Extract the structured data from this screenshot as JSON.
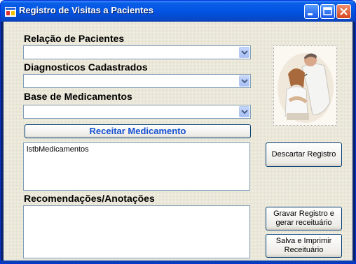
{
  "window": {
    "title": "Registro de Visitas a Pacientes"
  },
  "labels": {
    "pacientes": "Relação de Pacientes",
    "diagnosticos": "Diagnosticos Cadastrados",
    "medicamentos": "Base de Medicamentos",
    "recomendacoes": "Recomendações/Anotações"
  },
  "combos": {
    "pacientes": "",
    "diagnosticos": "",
    "medicamentos": ""
  },
  "buttons": {
    "receitar": "Receitar Medicamento",
    "descartar": "Descartar Registro",
    "gravar": "Gravar  Registro e gerar receituário",
    "salvar": "Salva e Imprimir Receituário"
  },
  "listbox": {
    "medicamentos_text": "lstbMedicamentos"
  },
  "textarea": {
    "recomendacoes_text": ""
  },
  "colors": {
    "title_bar": "#0254e3",
    "client_bg": "#ece9d8",
    "accent_text": "#1550d0"
  }
}
